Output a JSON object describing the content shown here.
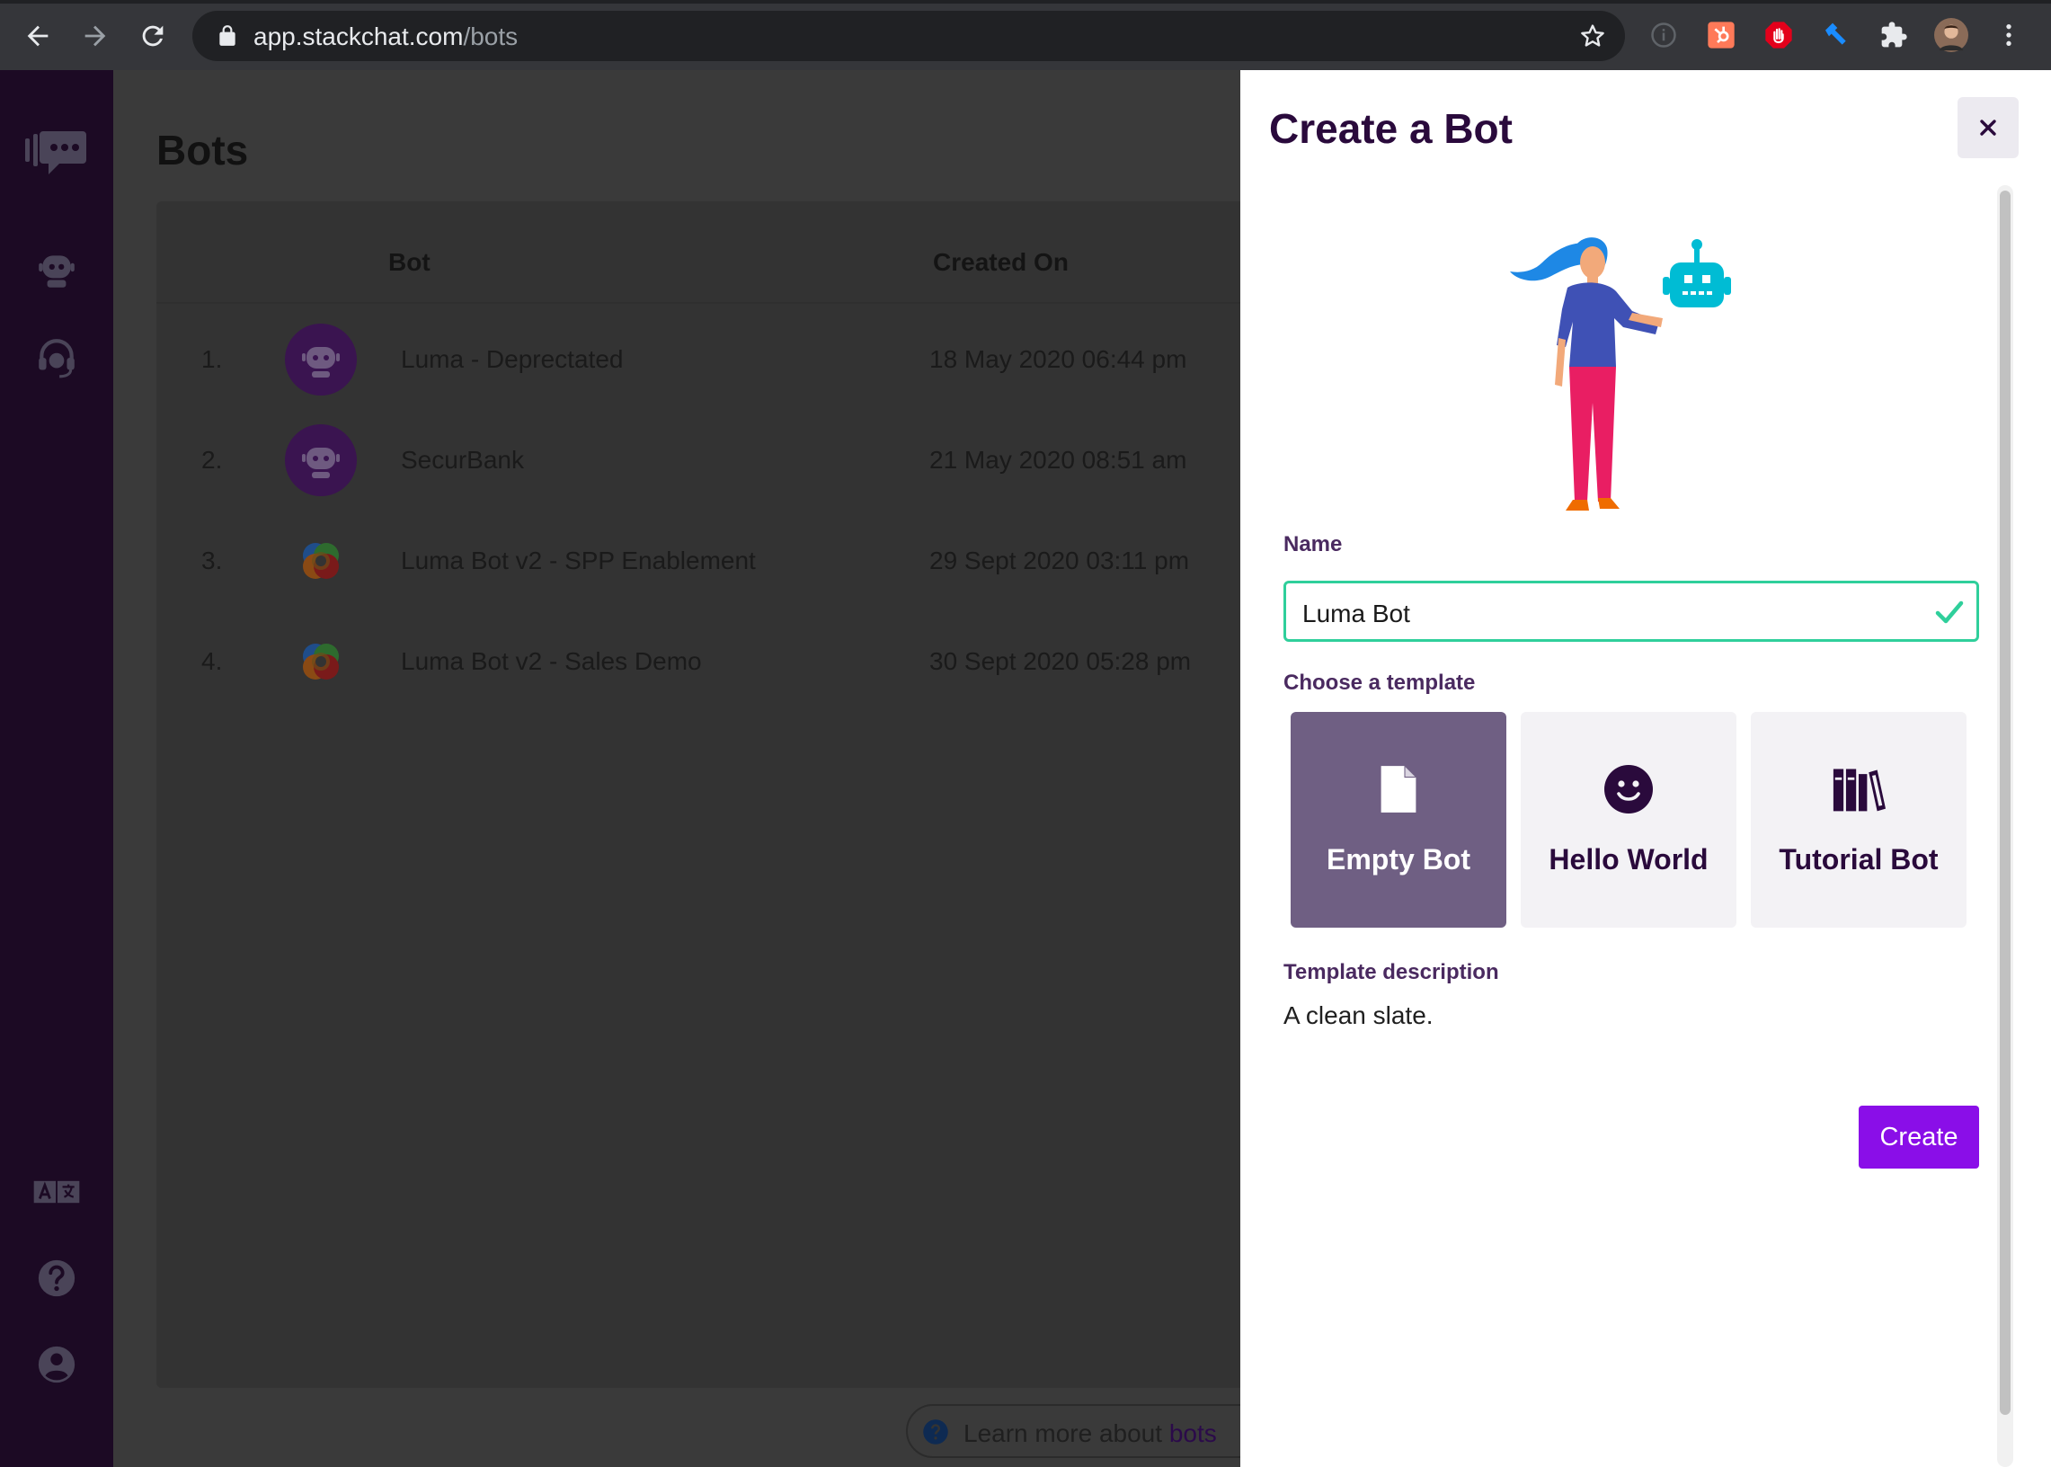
{
  "browser": {
    "url_host": "app.stackchat.com",
    "url_path": "/bots"
  },
  "page": {
    "title": "Bots",
    "columns": {
      "bot": "Bot",
      "created_on": "Created On"
    },
    "bots": [
      {
        "num": "1.",
        "name": "Luma - Deprectated",
        "created": "18 May 2020 06:44 pm",
        "avatar": "robot-avatar"
      },
      {
        "num": "2.",
        "name": "SecurBank",
        "created": "21 May 2020 08:51 am",
        "avatar": "robot-avatar"
      },
      {
        "num": "3.",
        "name": "Luma Bot v2 - SPP Enablement",
        "created": "29 Sept 2020 03:11 pm",
        "avatar": "ring-avatar"
      },
      {
        "num": "4.",
        "name": "Luma Bot v2 - Sales Demo",
        "created": "30 Sept 2020 05:28 pm",
        "avatar": "ring-avatar"
      }
    ],
    "learn_more": {
      "prefix": "Learn more about ",
      "link": "bots"
    }
  },
  "drawer": {
    "title": "Create a Bot",
    "name_label": "Name",
    "name_value": "Luma Bot",
    "template_label": "Choose a template",
    "templates": [
      {
        "label": "Empty Bot",
        "icon": "document-icon",
        "selected": true
      },
      {
        "label": "Hello World",
        "icon": "smiley-icon",
        "selected": false
      },
      {
        "label": "Tutorial Bot",
        "icon": "books-icon",
        "selected": false
      }
    ],
    "description_label": "Template description",
    "description": "A clean slate.",
    "create_label": "Create"
  },
  "colors": {
    "accent": "#8a0ee8",
    "selected_template": "#6f5f83",
    "valid": "#2fcf9b",
    "sidebar": "#1c0a24",
    "title": "#2a0a3c"
  }
}
